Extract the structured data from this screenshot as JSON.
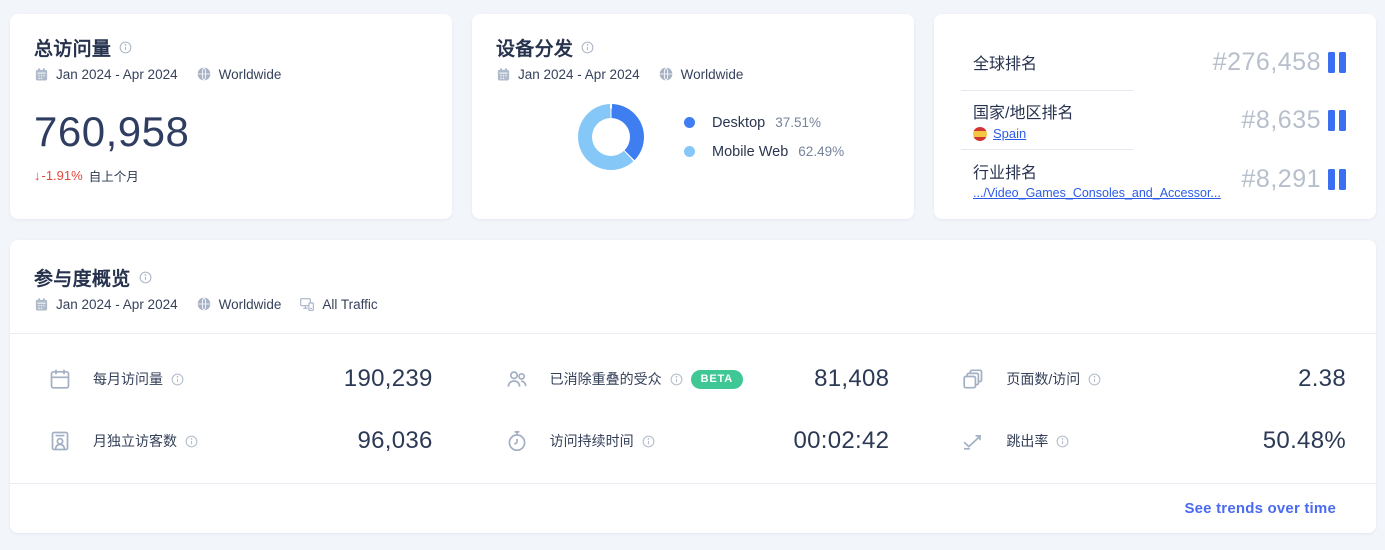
{
  "cards": {
    "total_visits": {
      "title": "总访问量",
      "date_range": "Jan 2024 - Apr 2024",
      "region": "Worldwide",
      "value": "760,958",
      "change_arrow": "↓",
      "change": "-1.91%",
      "change_note": "自上个月"
    },
    "device_distribution": {
      "title": "设备分发",
      "date_range": "Jan 2024 - Apr 2024",
      "region": "Worldwide"
    },
    "rankings": {
      "rows": [
        {
          "label": "全球排名",
          "value": "#276,458"
        },
        {
          "label": "国家/地区排名",
          "link": "Spain",
          "value": "#8,635"
        },
        {
          "label": "行业排名",
          "link": ".../Video_Games_Consoles_and_Accessor...",
          "value": "#8,291"
        }
      ]
    }
  },
  "chart_data": {
    "type": "pie",
    "title": "设备分发",
    "categories": [
      "Desktop",
      "Mobile Web"
    ],
    "values": [
      37.51,
      62.49
    ],
    "display_values": [
      "37.51%",
      "62.49%"
    ],
    "colors": [
      "#3E7EF0",
      "#85C8F8"
    ],
    "legend_position": "right",
    "donut": true,
    "start_angle_deg": 0
  },
  "engagement": {
    "title": "参与度概览",
    "date_range": "Jan 2024 - Apr 2024",
    "region": "Worldwide",
    "traffic": "All Traffic",
    "metrics": [
      {
        "label": "每月访问量",
        "value": "190,239"
      },
      {
        "label": "已消除重叠的受众",
        "badge": "BETA",
        "value": "81,408"
      },
      {
        "label": "页面数/访问",
        "value": "2.38"
      },
      {
        "label": "月独立访客数",
        "value": "96,036"
      },
      {
        "label": "访问持续时间",
        "value": "00:02:42"
      },
      {
        "label": "跳出率",
        "value": "50.48%"
      }
    ],
    "footer_link": "See trends over time"
  }
}
